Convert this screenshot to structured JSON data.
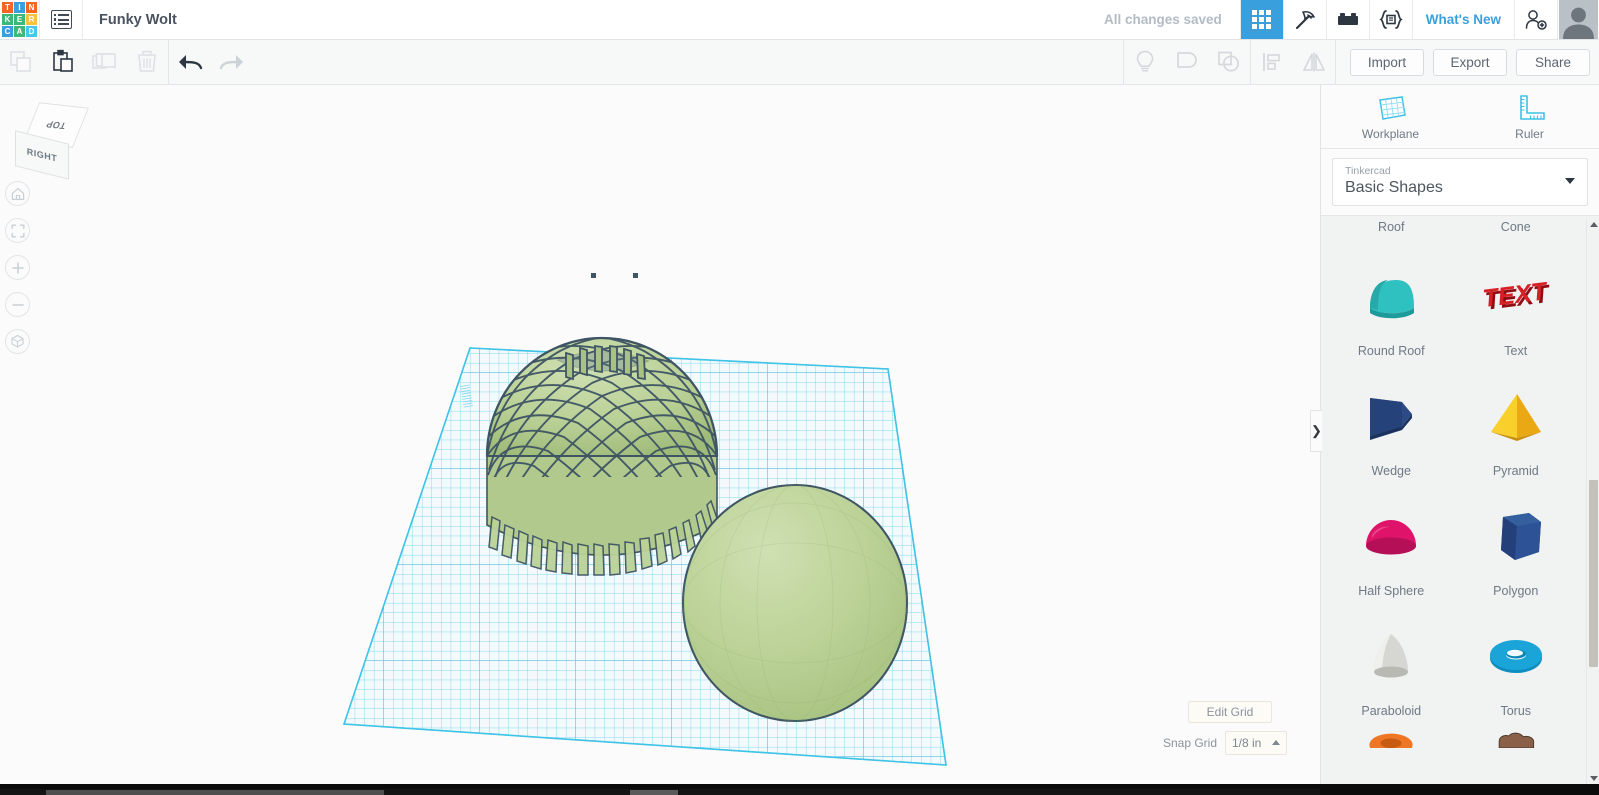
{
  "app": {
    "name": "Tinkercad",
    "logo_letters": [
      {
        "ch": "T",
        "color": "#f26722"
      },
      {
        "ch": "I",
        "color": "#3aa0dd"
      },
      {
        "ch": "N",
        "color": "#f26722"
      },
      {
        "ch": "K",
        "color": "#3cb878"
      },
      {
        "ch": "E",
        "color": "#3cb878"
      },
      {
        "ch": "R",
        "color": "#f5c242"
      },
      {
        "ch": "C",
        "color": "#3aa0dd"
      },
      {
        "ch": "A",
        "color": "#3cb878"
      },
      {
        "ch": "D",
        "color": "#46c8e8"
      }
    ]
  },
  "topbar": {
    "menu_icon": "hamburger-list-icon",
    "design_title": "Funky Wolt",
    "save_status": "All changes saved",
    "mode_tabs": [
      {
        "name": "grid-view",
        "icon": "grid-icon",
        "active": true
      },
      {
        "name": "codeblocks-pickaxe",
        "icon": "pickaxe-icon",
        "active": false
      },
      {
        "name": "bricks",
        "icon": "lego-brick-icon",
        "active": false
      },
      {
        "name": "codeblocks",
        "icon": "code-brackets-icon",
        "active": false
      }
    ],
    "whats_new": "What's New",
    "invite_icon": "add-person-icon",
    "avatar": "user-avatar"
  },
  "toolbar": {
    "left_tools": [
      {
        "name": "copy-button",
        "icon": "copy-icon",
        "enabled": false
      },
      {
        "name": "paste-button",
        "icon": "paste-icon",
        "enabled": true
      },
      {
        "name": "duplicate-button",
        "icon": "duplicate-icon",
        "enabled": false
      },
      {
        "name": "delete-button",
        "icon": "trash-icon",
        "enabled": false
      },
      {
        "name": "undo-button",
        "icon": "undo-arrow-icon",
        "enabled": true
      },
      {
        "name": "redo-button",
        "icon": "redo-arrow-icon",
        "enabled": false
      }
    ],
    "right_tools": [
      {
        "name": "hint-button",
        "icon": "lightbulb-icon",
        "enabled": false
      },
      {
        "name": "group-button",
        "icon": "group-shapes-icon",
        "enabled": false
      },
      {
        "name": "ungroup-button",
        "icon": "ungroup-shapes-icon",
        "enabled": false
      },
      {
        "name": "align-button",
        "icon": "align-icon",
        "enabled": false
      },
      {
        "name": "mirror-button",
        "icon": "mirror-flip-icon",
        "enabled": false
      }
    ],
    "import_label": "Import",
    "export_label": "Export",
    "share_label": "Share"
  },
  "canvas": {
    "viewcube": {
      "top_face": "TOP",
      "front_face": "RIGHT"
    },
    "nav_buttons": [
      {
        "name": "home-view-button",
        "icon": "home-icon"
      },
      {
        "name": "fit-view-button",
        "icon": "fit-to-screen-icon"
      },
      {
        "name": "zoom-in-button",
        "icon": "plus-icon"
      },
      {
        "name": "zoom-out-button",
        "icon": "minus-icon"
      },
      {
        "name": "perspective-toggle-button",
        "icon": "cube-perspective-icon"
      }
    ],
    "edit_grid_label": "Edit Grid",
    "snap_grid_label": "Snap Grid",
    "snap_grid_value": "1/8 in",
    "shape_color": "#b7ce92",
    "shape_outline": "#3f5564",
    "grid_color": "#45c8e8",
    "objects": [
      {
        "name": "lattice-dome",
        "type": "woven-mesh-hemisphere"
      },
      {
        "name": "solid-sphere",
        "type": "sphere"
      }
    ]
  },
  "rightpanel": {
    "workplane_label": "Workplane",
    "ruler_label": "Ruler",
    "library_source": "Tinkercad",
    "library_name": "Basic Shapes",
    "collapse_icon": "chevron-right-icon",
    "shapes_partial_top": [
      {
        "label": "Roof"
      },
      {
        "label": "Cone"
      }
    ],
    "shapes": [
      {
        "label": "Round Roof",
        "color": "#22b2b2",
        "icon": "round-roof-shape"
      },
      {
        "label": "Text",
        "color": "#d81f26",
        "icon": "text-shape"
      },
      {
        "label": "Wedge",
        "color": "#27437c",
        "icon": "wedge-shape"
      },
      {
        "label": "Pyramid",
        "color": "#f5c21e",
        "icon": "pyramid-shape"
      },
      {
        "label": "Half Sphere",
        "color": "#e0136b",
        "icon": "half-sphere-shape"
      },
      {
        "label": "Polygon",
        "color": "#2a4a86",
        "icon": "polygon-shape"
      },
      {
        "label": "Paraboloid",
        "color": "#c9c9c4",
        "icon": "paraboloid-shape"
      },
      {
        "label": "Torus",
        "color": "#1ba4d8",
        "icon": "torus-shape"
      }
    ],
    "shapes_partial_bottom": [
      {
        "label": "",
        "color": "#ef7622",
        "icon": "tube-shape"
      },
      {
        "label": "",
        "color": "#8a6148",
        "icon": "blob-shape"
      }
    ]
  }
}
